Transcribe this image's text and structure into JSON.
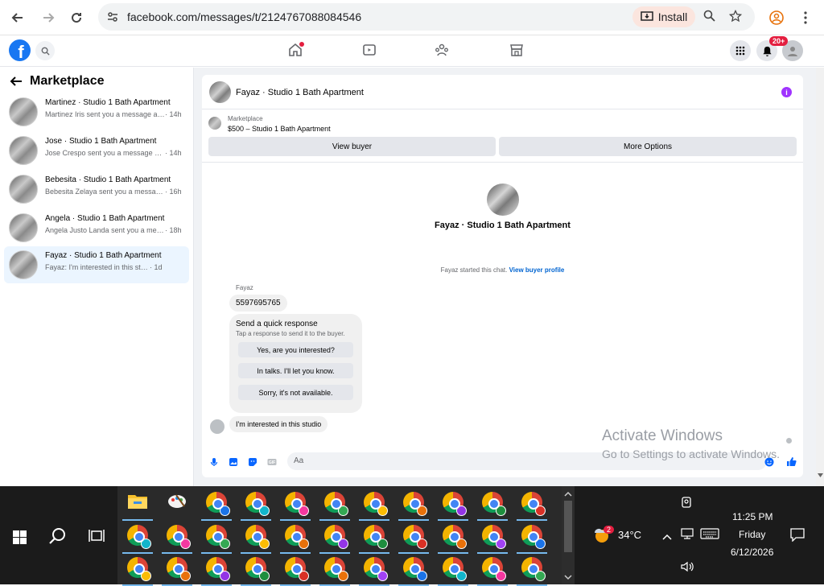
{
  "browser": {
    "url": "facebook.com/messages/t/2124767088084546",
    "install_label": "Install"
  },
  "fbnav": {
    "notif_badge": "20+"
  },
  "sidebar": {
    "title": "Marketplace",
    "conversations": [
      {
        "title": "Martinez · Studio 1 Bath Apartment",
        "preview": "Martinez Iris sent you a message abo...",
        "time": "· 14h"
      },
      {
        "title": "Jose · Studio 1 Bath Apartment",
        "preview": "Jose Crespo sent you a message abo...",
        "time": "· 14h"
      },
      {
        "title": "Bebesita · Studio 1 Bath Apartment",
        "preview": "Bebesita Zelaya sent you a message ...",
        "time": "· 16h"
      },
      {
        "title": "Angela · Studio 1 Bath Apartment",
        "preview": "Angela Justo Landa sent you a mess...",
        "time": "· 18h"
      },
      {
        "title": "Fayaz · Studio 1 Bath Apartment",
        "preview": "Fayaz: I'm interested in this studio",
        "time": "· 1d"
      }
    ]
  },
  "chat": {
    "header_title": "Fayaz · Studio 1 Bath Apartment",
    "marketplace_label": "Marketplace",
    "listing": "$500 – Studio 1 Bath Apartment",
    "view_buyer_label": "View buyer",
    "more_options_label": "More Options",
    "big_title": "Fayaz · Studio 1 Bath Apartment",
    "started_text": "Fayaz started this chat.",
    "view_profile_link": "View buyer profile",
    "sender_name": "Fayaz",
    "message_phone": "5597695765",
    "quick_response_title": "Send a quick response",
    "quick_response_sub": "Tap a response to send it to the buyer.",
    "quick_responses": [
      "Yes, are you interested?",
      "In talks. I'll let you know.",
      "Sorry, it's not available."
    ],
    "last_message": "I'm interested in this studio",
    "composer_placeholder": "Aa"
  },
  "watermark": {
    "line1": "Activate Windows",
    "line2": "Go to Settings to activate Windows."
  },
  "taskbar": {
    "temperature": "34°C",
    "weather_badge": "2",
    "time": "11:25 PM",
    "day": "Friday",
    "date": "6/12/2026"
  },
  "colors": {
    "fb_blue": "#1877f2",
    "link_blue": "#0064d1",
    "info_purple": "#a033ff",
    "badge_red": "#e41e3f"
  }
}
